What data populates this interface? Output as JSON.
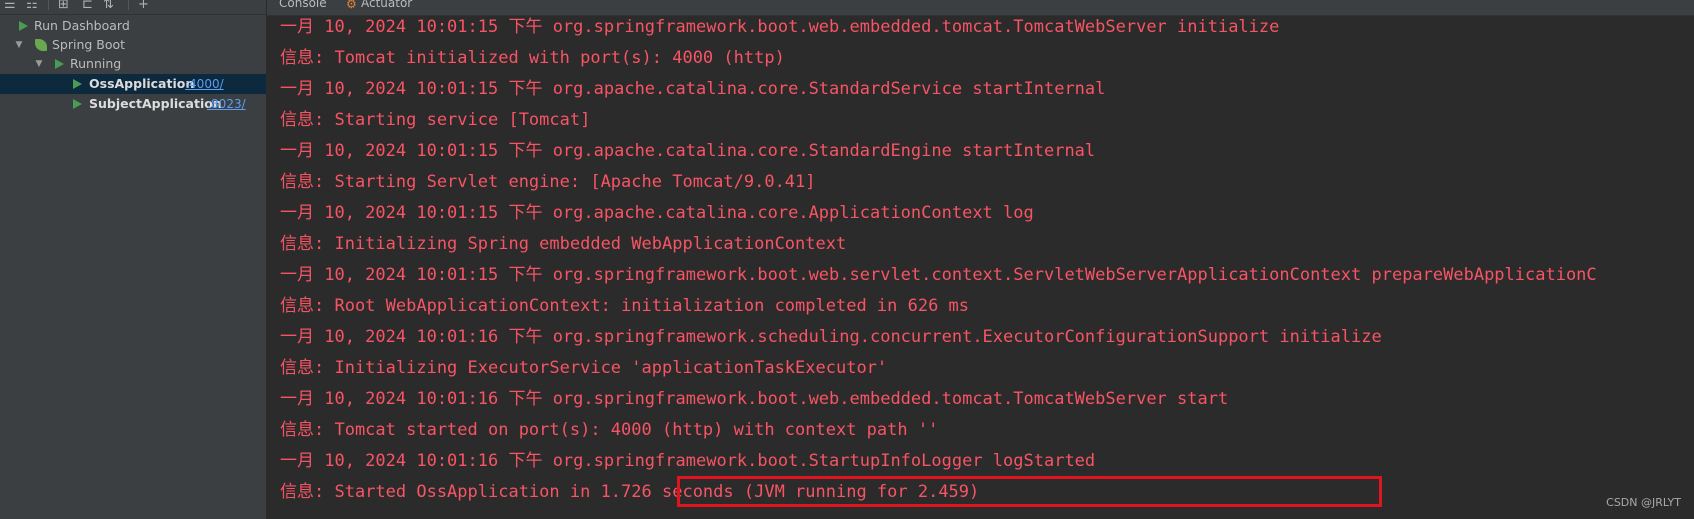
{
  "console_tabs": {
    "console_label": "Console",
    "actuator_label": "Actuator"
  },
  "tree": {
    "root_label": "Run Dashboard",
    "group_label": "Spring Boot",
    "status_label": "Running",
    "apps": [
      {
        "name": "OssApplication",
        "port": ":4000/"
      },
      {
        "name": "SubjectApplication",
        "port": ":8023/"
      }
    ]
  },
  "log_lines": [
    "一月 10, 2024 10:01:15 下午 org.springframework.boot.web.embedded.tomcat.TomcatWebServer initialize",
    "信息: Tomcat initialized with port(s): 4000 (http)",
    "一月 10, 2024 10:01:15 下午 org.apache.catalina.core.StandardService startInternal",
    "信息: Starting service [Tomcat]",
    "一月 10, 2024 10:01:15 下午 org.apache.catalina.core.StandardEngine startInternal",
    "信息: Starting Servlet engine: [Apache Tomcat/9.0.41]",
    "一月 10, 2024 10:01:15 下午 org.apache.catalina.core.ApplicationContext log",
    "信息: Initializing Spring embedded WebApplicationContext",
    "一月 10, 2024 10:01:15 下午 org.springframework.boot.web.servlet.context.ServletWebServerApplicationContext prepareWebApplicationC",
    "信息: Root WebApplicationContext: initialization completed in 626 ms",
    "一月 10, 2024 10:01:16 下午 org.springframework.scheduling.concurrent.ExecutorConfigurationSupport initialize",
    "信息: Initializing ExecutorService 'applicationTaskExecutor'",
    "一月 10, 2024 10:01:16 下午 org.springframework.boot.web.embedded.tomcat.TomcatWebServer start",
    "信息: Tomcat started on port(s): 4000 (http) with context path ''",
    "一月 10, 2024 10:01:16 下午 org.springframework.boot.StartupInfoLogger logStarted",
    "信息: Started OssApplication in 1.726 seconds (JVM running for 2.459)"
  ],
  "watermark": "CSDN @JRLYT",
  "colors": {
    "log_text": "#f75464",
    "highlight_box": "#e0141e",
    "run_icon": "#499c54",
    "link": "#589df6"
  }
}
